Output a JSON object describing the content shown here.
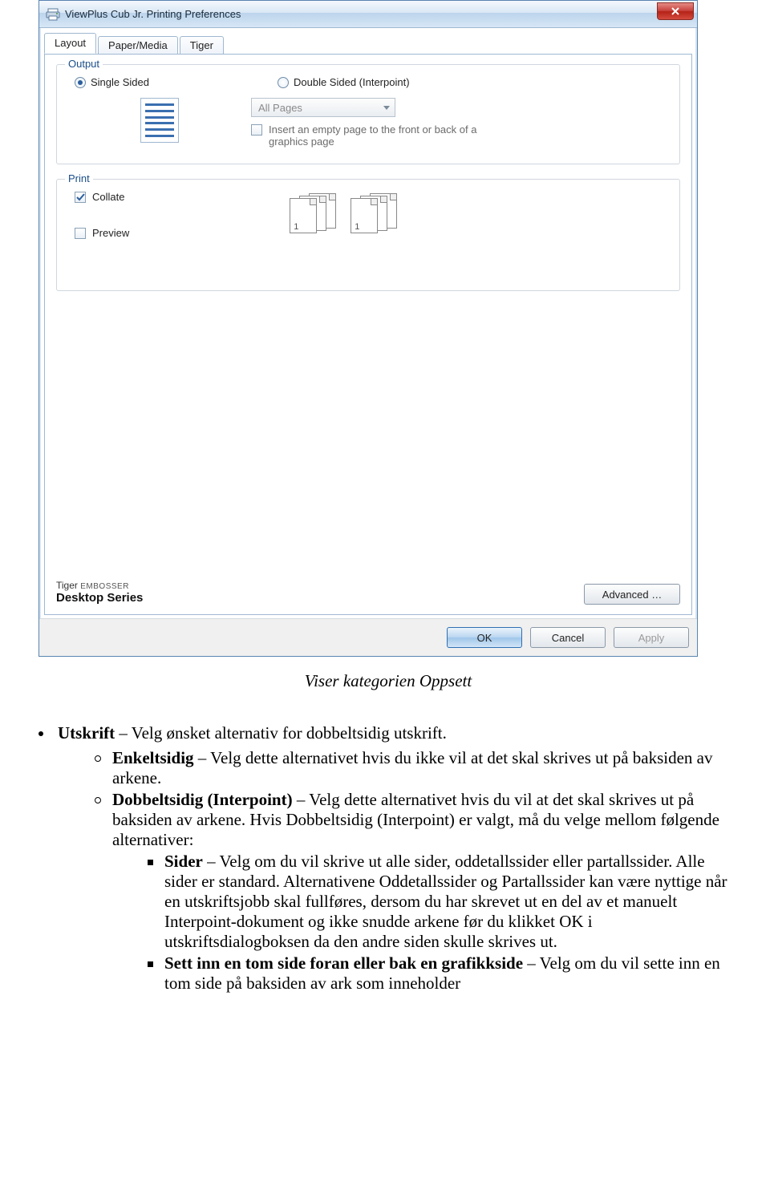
{
  "dialog": {
    "title": "ViewPlus Cub Jr. Printing Preferences",
    "tabs": {
      "layout": "Layout",
      "paper": "Paper/Media",
      "tiger": "Tiger"
    },
    "output": {
      "legend": "Output",
      "single": "Single Sided",
      "double": "Double Sided (Interpoint)",
      "combo": "All Pages",
      "insert": "Insert an empty page to the front or back of a graphics page"
    },
    "print": {
      "legend": "Print",
      "collate": "Collate",
      "preview": "Preview"
    },
    "branding": {
      "tiger": "Tiger",
      "embosser": "EMBOSSER",
      "series": "Desktop Series"
    },
    "advanced": "Advanced …",
    "buttons": {
      "ok": "OK",
      "cancel": "Cancel",
      "apply": "Apply"
    }
  },
  "doc": {
    "caption": "Viser kategorien Oppsett",
    "bullet0_bold": "Utskrift",
    "bullet0_rest": " – Velg ønsket alternativ for dobbeltsidig utskrift.",
    "sub1_bold": "Enkeltsidig",
    "sub1_rest": " – Velg dette alternativet hvis du ikke vil at det skal skrives ut på baksiden av arkene.",
    "sub2_bold": "Dobbeltsidig (Interpoint)",
    "sub2_rest": " – Velg dette alternativet hvis du vil at det skal skrives ut på baksiden av arkene. Hvis Dobbeltsidig (Interpoint) er valgt, må du velge mellom følgende alternativer:",
    "sub3_bold": "Sider",
    "sub3_rest": " – Velg om du vil skrive ut alle sider, oddetallssider eller partallssider. Alle sider er standard. Alternativene Oddetallssider og Partallssider kan være nyttige når en utskriftsjobb skal fullføres, dersom du har skrevet ut en del av et manuelt Interpoint-dokument og ikke snudde arkene før du klikket OK i utskriftsdialogboksen da den andre siden skulle skrives ut.",
    "sub4_bold": "Sett inn en tom side foran eller bak en grafikkside",
    "sub4_rest": " – Velg om du vil sette inn en tom side på baksiden av ark som inneholder"
  }
}
